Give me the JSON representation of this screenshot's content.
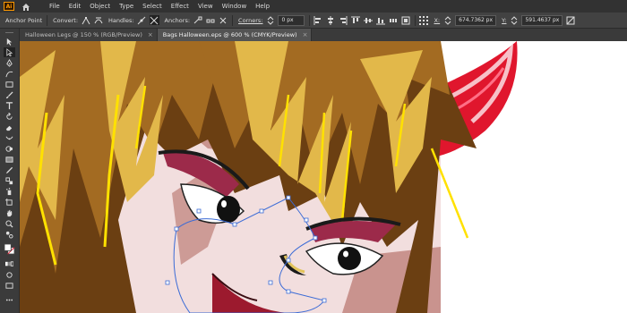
{
  "app": {
    "logo": "Ai",
    "home_icon": "home-icon"
  },
  "menu": [
    "File",
    "Edit",
    "Object",
    "Type",
    "Select",
    "Effect",
    "View",
    "Window",
    "Help"
  ],
  "control_bar": {
    "tool_name": "Anchor Point",
    "convert_label": "Convert:",
    "handles_label": "Handles:",
    "anchors_label": "Anchors:",
    "corners_label": "Corners:",
    "corners_value": "0 px",
    "x_label": "X:",
    "x_value": "674.7362 px",
    "y_label": "Y:",
    "y_value": "591.4637 px"
  },
  "tabs": [
    {
      "label": "Halloween Legs @ 150 % (RGB/Preview)",
      "close": "×",
      "active": false
    },
    {
      "label": "Bags Halloween.eps @ 600 % (CMYK/Preview)",
      "close": "×",
      "active": true
    }
  ],
  "tools": [
    "selection-tool-icon",
    "direct-selection-tool-icon",
    "pen-tool-icon",
    "curvature-tool-icon",
    "rectangle-tool-icon",
    "paintbrush-tool-icon",
    "type-tool-icon",
    "rotate-tool-icon",
    "eraser-tool-icon",
    "width-tool-icon",
    "shape-builder-tool-icon",
    "gradient-tool-icon",
    "eyedropper-tool-icon",
    "blend-tool-icon",
    "symbol-sprayer-tool-icon",
    "artboard-tool-icon",
    "slice-tool-icon",
    "hand-tool-icon",
    "zoom-tool-icon",
    "fill-stroke-icon",
    "screen-mode-icon",
    "more-tools-icon"
  ],
  "colors": {
    "hair_dark": "#6b3f12",
    "hair_mid": "#a36b22",
    "hair_light": "#e2b84a",
    "hair_highlight": "#ffe100",
    "skin": "#f2dede",
    "skin_shadow": "#c9938e",
    "horn": "#e0162d",
    "eyeshadow": "#9c2a4a",
    "selection": "#3b6bd6"
  }
}
